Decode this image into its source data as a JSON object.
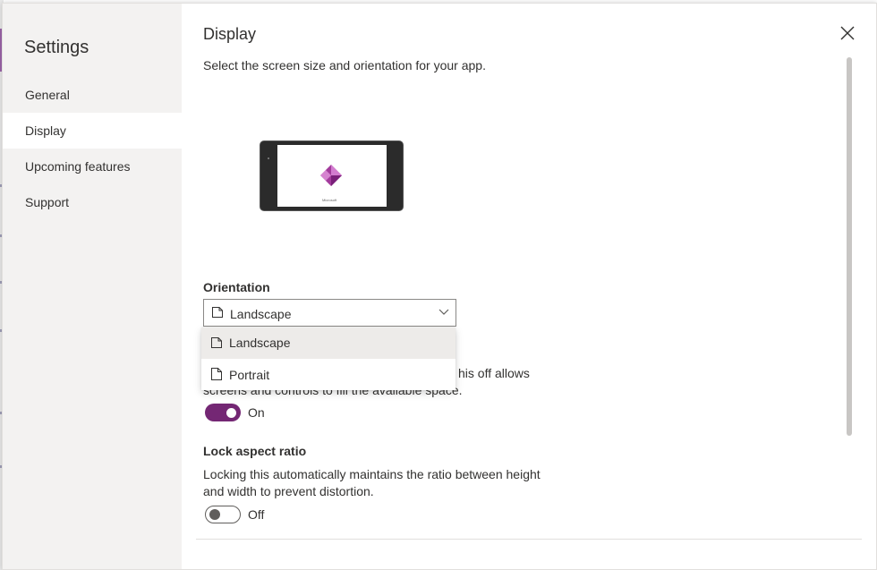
{
  "sidebar": {
    "title": "Settings",
    "items": [
      {
        "label": "General"
      },
      {
        "label": "Display"
      },
      {
        "label": "Upcoming features"
      },
      {
        "label": "Support"
      }
    ],
    "active": "Display"
  },
  "main": {
    "title": "Display",
    "subtitle": "Select the screen size and orientation for your app.",
    "preview": {
      "brand_text": "Microsoft"
    },
    "orientation": {
      "label": "Orientation",
      "value": "Landscape",
      "options": [
        "Landscape",
        "Portrait"
      ],
      "highlighted": "Landscape"
    },
    "scale_to_fit": {
      "description_line1_visible": "his off allows",
      "description_line2_partial": "screens and controls to fill the available space.",
      "state": "On"
    },
    "lock_aspect": {
      "label": "Lock aspect ratio",
      "description_line1": "Locking this automatically maintains the ratio between height",
      "description_line2": "and width to prevent distortion.",
      "state": "Off"
    }
  },
  "colors": {
    "accent": "#742774",
    "sidebar_bg": "#f3f2f1",
    "menu_hover": "#edebe9"
  },
  "icons": {
    "close": "close-icon",
    "dropdown": "chevron-down-icon",
    "landscape": "landscape-page-icon",
    "portrait": "portrait-page-icon"
  }
}
